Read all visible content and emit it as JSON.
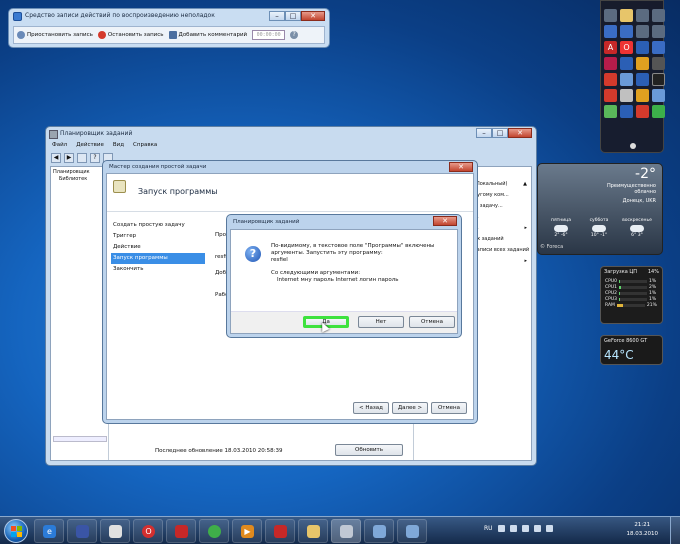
{
  "psr": {
    "title": "Средство записи действий по воспроизведению неполадок",
    "pause_label": "Приостановить запись",
    "stop_label": "Остановить запись",
    "comment_label": "Добавить комментарий",
    "timer": "00:00:00",
    "help": "?"
  },
  "gadgets": {
    "weather": {
      "temp": "-2°",
      "desc_line1": "Преимущественно",
      "desc_line2": "облачно",
      "city": "Донецк, UKR",
      "days": [
        {
          "name": "пятница",
          "temps": "2° -6°"
        },
        {
          "name": "суббота",
          "temps": "10° -1°"
        },
        {
          "name": "воскресенье",
          "temps": "6° 3°"
        }
      ],
      "source": "© Foreca"
    },
    "cpu": {
      "title": "Загрузка ЦП",
      "value": "14%",
      "cores": [
        {
          "label": "CPU0",
          "pct": "1%"
        },
        {
          "label": "CPU1",
          "pct": "2%"
        },
        {
          "label": "CPU2",
          "pct": "1%"
        },
        {
          "label": "CPU3",
          "pct": "1%"
        },
        {
          "label": "RAM",
          "pct": "21%"
        }
      ]
    },
    "gpu": {
      "name": "GeForce 8600 GT",
      "temp": "44°C"
    }
  },
  "scheduler": {
    "title": "Планировщик заданий",
    "menu": [
      "Файл",
      "Действие",
      "Вид",
      "Справка"
    ],
    "tree": [
      "Планировщик",
      "Библиотек"
    ],
    "actions_head": "(Локальный)",
    "actions": [
      "ругому ком...",
      "ю задачу...",
      "...",
      "...",
      "ех заданий",
      "записи всех заданий",
      "",
      ""
    ],
    "status": "Последнее обновление 18.03.2010 20:58:39",
    "refresh_label": "Обновить"
  },
  "wizard": {
    "title": "Мастер создания простой задачи",
    "header": "Запуск программы",
    "steps": [
      "Создать простую задачу",
      "Триггер",
      "Действие",
      "Запуск программы",
      "Закончить"
    ],
    "selected_step": 3,
    "right_labels": [
      "Про",
      "resfi",
      "Доб",
      "Рабо"
    ],
    "back_label": "< Назад",
    "next_label": "Далее >",
    "cancel_label": "Отмена"
  },
  "dialog": {
    "title": "Планировщик заданий",
    "line1": "По-видимому, в текстовое поле \"Программы\" включены",
    "line2": "аргументы. Запустить эту программу:",
    "line3": "resfiel",
    "line4": "Со следующими аргументами:",
    "line5": "Internet мну пароль Internet логин пароль",
    "yes_label": "Да",
    "no_label": "Нет",
    "cancel_label": "Отмена"
  },
  "taskbar": {
    "lang": "RU",
    "time": "21:21",
    "date": "18.03.2010"
  }
}
